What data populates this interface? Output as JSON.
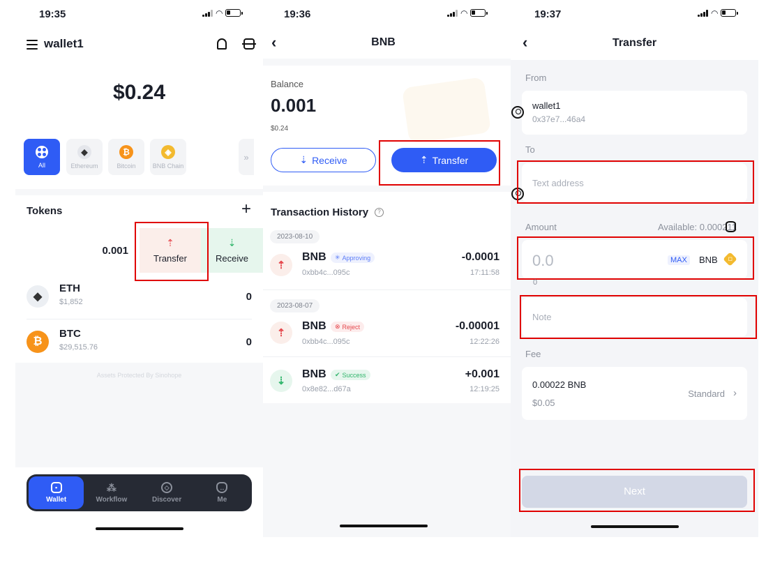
{
  "screen1": {
    "time": "19:35",
    "wallet_name": "wallet1",
    "balance": "$0.24",
    "chains": [
      {
        "label": "All",
        "icon": "grid-icon",
        "active": true
      },
      {
        "label": "Ethereum",
        "icon": "ethereum-icon"
      },
      {
        "label": "Bitcoin",
        "icon": "bitcoin-icon"
      },
      {
        "label": "BNB Chain",
        "icon": "bnb-icon"
      }
    ],
    "more_chains": "»",
    "tokens_title": "Tokens",
    "add_symbol": "+",
    "swiped_amount": "0.001",
    "swipe_actions": {
      "transfer": "Transfer",
      "receive": "Receive"
    },
    "tokens": [
      {
        "symbol": "ETH",
        "price": "$1,852",
        "amount": "0",
        "icon": "ethereum-icon",
        "color": "#eceff3"
      },
      {
        "symbol": "BTC",
        "price": "$29,515.76",
        "amount": "0",
        "icon": "bitcoin-icon",
        "color": "#f7931a"
      }
    ],
    "footer_note": "Assets Protected By Sinohope",
    "nav": [
      {
        "label": "Wallet",
        "icon": "wallet-icon",
        "active": true
      },
      {
        "label": "Workflow",
        "icon": "workflow-icon"
      },
      {
        "label": "Discover",
        "icon": "compass-icon"
      },
      {
        "label": "Me",
        "icon": "profile-icon"
      }
    ]
  },
  "screen2": {
    "time": "19:36",
    "title": "BNB",
    "balance_label": "Balance",
    "balance": "0.001",
    "balance_usd": "$0.24",
    "receive_label": "Receive",
    "transfer_label": "Transfer",
    "history_title": "Transaction History",
    "groups": [
      {
        "date": "2023-08-10",
        "items": [
          {
            "symbol": "BNB",
            "status": "Approving",
            "address": "0xbb4c...095c",
            "amount": "-0.0001",
            "time": "17:11:58",
            "direction": "out"
          }
        ]
      },
      {
        "date": "2023-08-07",
        "items": [
          {
            "symbol": "BNB",
            "status": "Reject",
            "address": "0xbb4c...095c",
            "amount": "-0.00001",
            "time": "12:22:26",
            "direction": "out"
          },
          {
            "symbol": "BNB",
            "status": "Success",
            "address": "0x8e82...d67a",
            "amount": "+0.001",
            "time": "12:19:25",
            "direction": "in"
          }
        ]
      }
    ],
    "colors": {
      "accent": "#2f5cf5",
      "approving": "#5b7cf7",
      "reject": "#e5484d",
      "success": "#30b56b"
    }
  },
  "screen3": {
    "time": "19:37",
    "title": "Transfer",
    "from_label": "From",
    "from_name": "wallet1",
    "from_address": "0x37e7...46a4",
    "to_label": "To",
    "to_placeholder": "Text address",
    "amount_label": "Amount",
    "available": "Available: 0.000211",
    "amount_placeholder": "0.0",
    "max_label": "MAX",
    "currency": "BNB",
    "amount_sub": "0",
    "note_placeholder": "Note",
    "fee_label": "Fee",
    "fee_amount": "0.00022 BNB",
    "fee_usd": "$0.05",
    "fee_speed": "Standard",
    "next_label": "Next"
  }
}
